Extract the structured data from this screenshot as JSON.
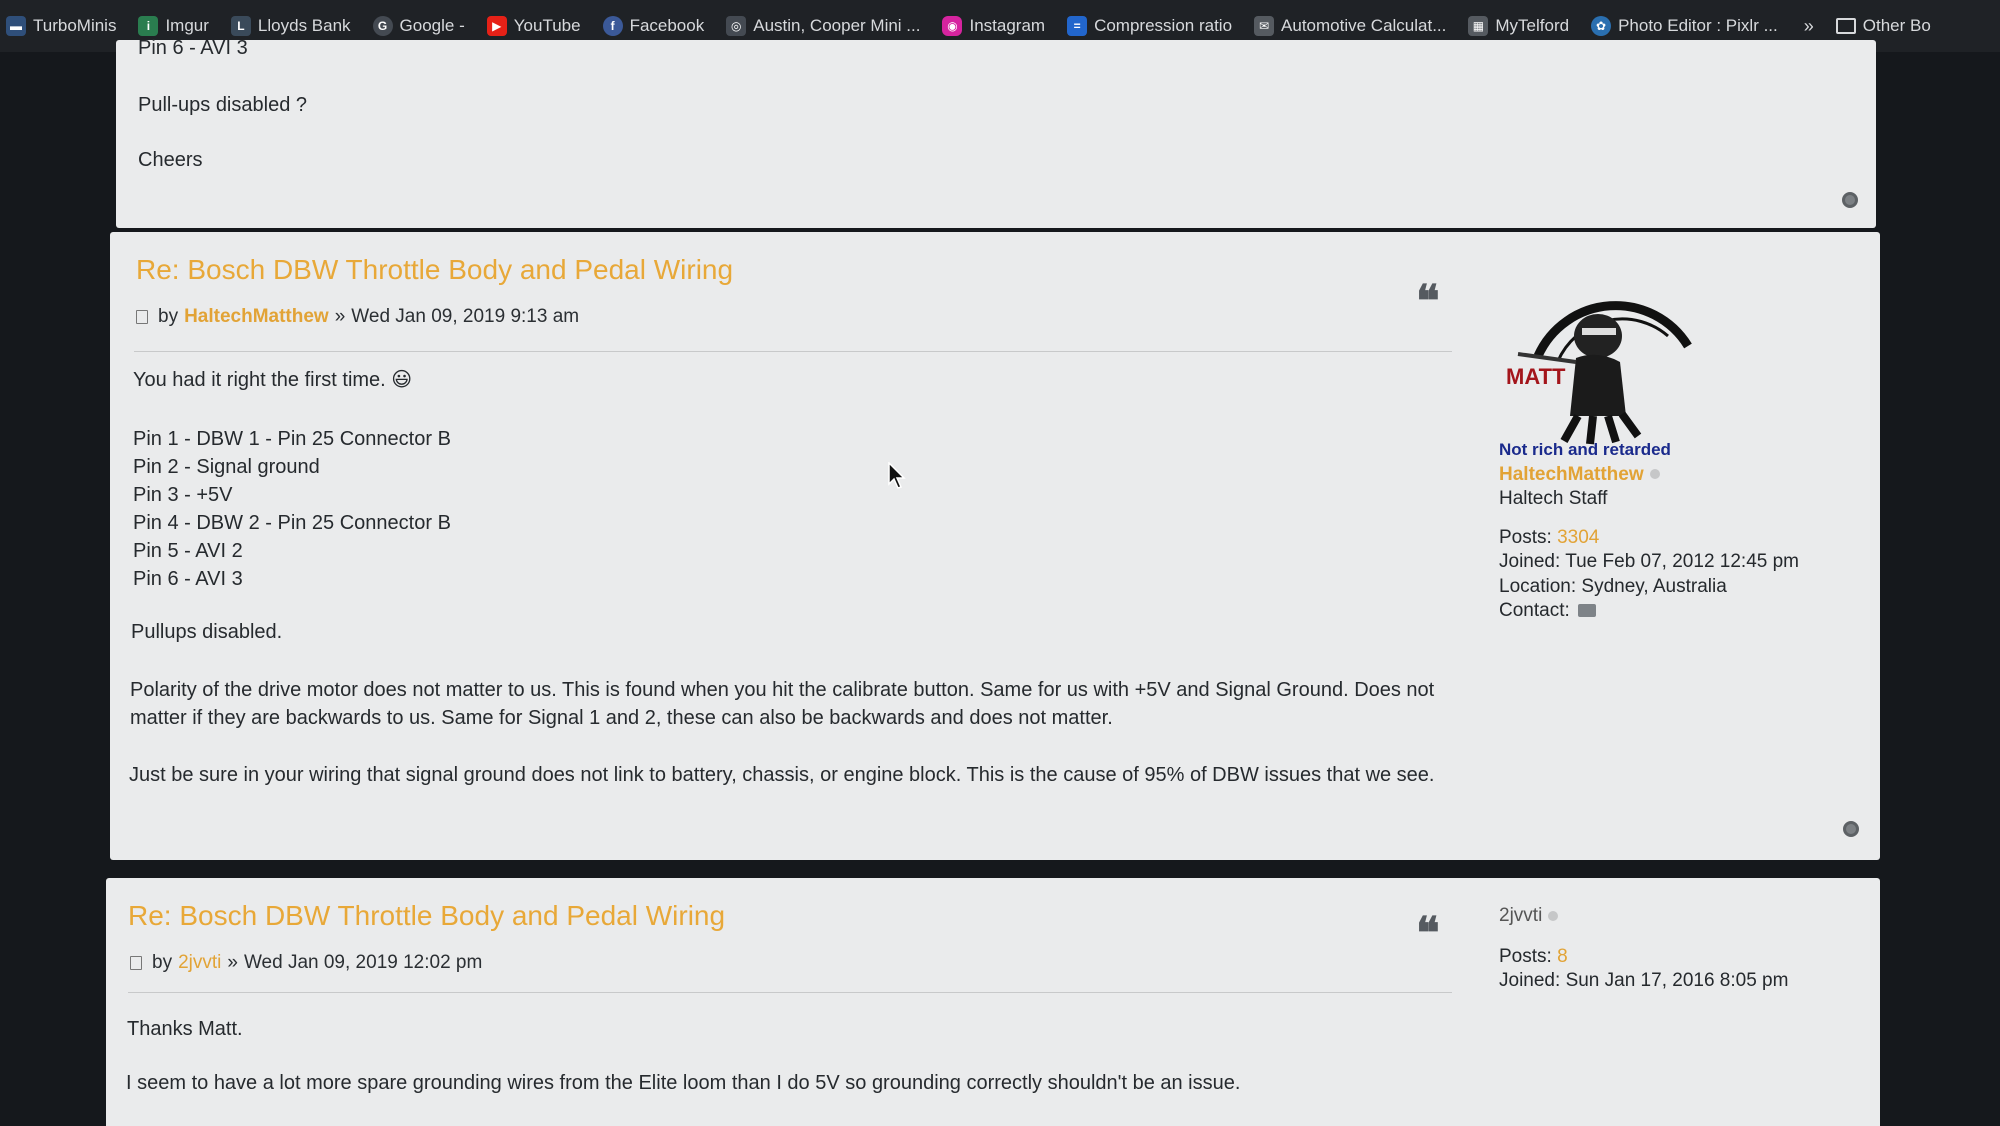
{
  "bookmarks": [
    {
      "label": "TurboMinis",
      "icon": "turbominis-icon",
      "color": "#2f4f7a"
    },
    {
      "label": "Imgur",
      "icon": "imgur-icon",
      "color": "#2a7d4f"
    },
    {
      "label": "Lloyds Bank",
      "icon": "lloyds-bank-icon",
      "color": "#3a4a5a"
    },
    {
      "label": "Google -",
      "icon": "google-icon",
      "color": "#444a52"
    },
    {
      "label": "YouTube",
      "icon": "youtube-icon",
      "color": "#e62117"
    },
    {
      "label": "Facebook",
      "icon": "facebook-icon",
      "color": "#3b5998"
    },
    {
      "label": "Austin, Cooper Mini ...",
      "icon": "austin-cooper-icon",
      "color": "#444a52"
    },
    {
      "label": "Instagram",
      "icon": "instagram-icon",
      "color": "#d6249f"
    },
    {
      "label": "Compression ratio",
      "icon": "compression-ratio-icon",
      "color": "#2266cc"
    },
    {
      "label": "Automotive Calculat...",
      "icon": "automotive-calculator-icon",
      "color": "#555a60"
    },
    {
      "label": "MyTelford",
      "icon": "mytelford-icon",
      "color": "#555a60"
    },
    {
      "label": "Photo Editor : Pixlr ...",
      "icon": "pixlr-icon",
      "color": "#2a6fb0"
    }
  ],
  "bookmarks_overflow": "»",
  "other_bookmarks": "Other Bo",
  "prev_post": {
    "lines": [
      "Pin 6 - AVI 3",
      "Pull-ups disabled ?",
      "Cheers"
    ]
  },
  "post_a": {
    "title": "Re: Bosch DBW Throttle Body and Pedal Wiring",
    "by": "by",
    "author": "HaltechMatthew",
    "sep": "»",
    "date": "Wed Jan 09, 2019 9:13 am",
    "intro": "You had it right the first time.",
    "emoji": "😃",
    "pins": [
      "Pin 1 - DBW 1 - Pin 25 Connector B",
      "Pin 2 - Signal ground",
      "Pin 3 - +5V",
      "Pin 4 - DBW 2 - Pin 25 Connector B",
      "Pin 5 - AVI 2",
      "Pin 6 - AVI 3"
    ],
    "pullups": "Pullups disabled.",
    "para1": "Polarity of the drive motor does not matter to us. This is found when you hit the calibrate button. Same for us with +5V and Signal Ground. Does not matter if they are backwards to us. Same for Signal 1 and 2, these can also be backwards and does not matter.",
    "para2": "Just be sure in your wiring that signal ground does not link to battery, chassis, or engine block. This is the cause of 95% of DBW issues that we see.",
    "profile": {
      "avatar_text": "MATT",
      "rank_title": "Not rich and retarded",
      "username": "HaltechMatthew",
      "rank": "Haltech Staff",
      "posts_label": "Posts:",
      "posts": "3304",
      "joined_label": "Joined:",
      "joined": "Tue Feb 07, 2012 12:45 pm",
      "location_label": "Location:",
      "location": "Sydney, Australia",
      "contact_label": "Contact:"
    }
  },
  "post_b": {
    "title": "Re: Bosch DBW Throttle Body and Pedal Wiring",
    "by": "by",
    "author": "2jvvti",
    "sep": "»",
    "date": "Wed Jan 09, 2019 12:02 pm",
    "line1": "Thanks Matt.",
    "line2": "I seem to have a lot more spare grounding wires from the Elite loom than I do 5V so grounding correctly shouldn't be an issue.",
    "profile": {
      "username": "2jvvti",
      "posts_label": "Posts:",
      "posts": "8",
      "joined_label": "Joined:",
      "joined": "Sun Jan 17, 2016 8:05 pm"
    }
  },
  "colors": {
    "accent": "#e8a838",
    "post_bg": "#eaebec",
    "page_bg": "#15181c",
    "rank_title": "#1a2a8c"
  }
}
